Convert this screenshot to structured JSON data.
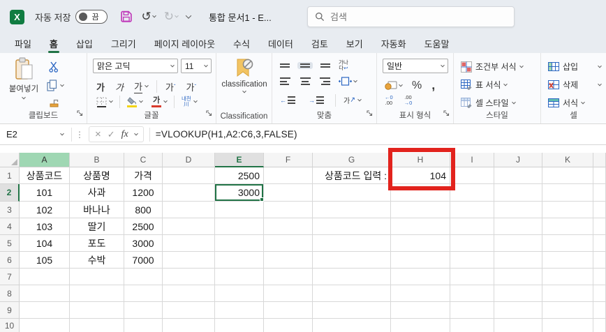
{
  "colors": {
    "accent_green": "#217346",
    "annotation_red": "#e2231d",
    "column_a_green": "#9fd7b3",
    "save_magenta": "#c03bba"
  },
  "titlebar": {
    "autosave_label": "자동 저장",
    "autosave_state": "끔",
    "document_title": "통합 문서1 - E...",
    "search_placeholder": "검색"
  },
  "tabs": {
    "items": [
      "파일",
      "홈",
      "삽입",
      "그리기",
      "페이지 레이아웃",
      "수식",
      "데이터",
      "검토",
      "보기",
      "자동화",
      "도움말"
    ],
    "active": "홈"
  },
  "ribbon": {
    "clipboard": {
      "paste_label": "붙여넣기",
      "group_label": "클립보드"
    },
    "font": {
      "font_name": "맑은 고딕",
      "font_size": "11",
      "bold": "가",
      "italic": "가",
      "underline": "가",
      "grow": "가",
      "shrink": "가",
      "phonetic_top": "내천",
      "group_label": "글꼴"
    },
    "classification": {
      "button_label": "classification",
      "group_label": "Classification"
    },
    "alignment": {
      "orientation_top": "가나",
      "orientation_bottom": "다",
      "rotate": "가",
      "group_label": "맞춤"
    },
    "number": {
      "format_value": "일반",
      "percent": "%",
      "comma": ",",
      "inc_top": "←0",
      "inc_bottom": ".00",
      "dec_top": ".00",
      "dec_bottom": "→0",
      "group_label": "표시 형식"
    },
    "styles": {
      "conditional_label": "조건부 서식",
      "table_label": "표 서식",
      "cell_styles_label": "셀 스타일",
      "group_label": "스타일"
    },
    "cells": {
      "insert_label": "삽입",
      "delete_label": "삭제",
      "format_label": "서식",
      "group_label": "셀"
    }
  },
  "formula_bar": {
    "name_box": "E2",
    "cancel": "×",
    "enter": "✓",
    "fx_label": "fx",
    "formula": "=VLOOKUP(H1,A2:C6,3,FALSE)"
  },
  "grid": {
    "selected_cell": "E2",
    "annotation_cell": "H1",
    "columns": [
      {
        "letter": "A",
        "width": 72,
        "state": "green"
      },
      {
        "letter": "B",
        "width": 78
      },
      {
        "letter": "C",
        "width": 55
      },
      {
        "letter": "D",
        "width": 75
      },
      {
        "letter": "E",
        "width": 70,
        "state": "selected"
      },
      {
        "letter": "F",
        "width": 70
      },
      {
        "letter": "G",
        "width": 112
      },
      {
        "letter": "H",
        "width": 85
      },
      {
        "letter": "I",
        "width": 63
      },
      {
        "letter": "J",
        "width": 69
      },
      {
        "letter": "K",
        "width": 73
      },
      {
        "letter": "",
        "width": 18
      }
    ],
    "rows": [
      {
        "n": "1",
        "h": 24
      },
      {
        "n": "2",
        "h": 25,
        "selected": true
      },
      {
        "n": "3",
        "h": 24
      },
      {
        "n": "4",
        "h": 24
      },
      {
        "n": "5",
        "h": 24
      },
      {
        "n": "6",
        "h": 24
      },
      {
        "n": "7",
        "h": 24
      },
      {
        "n": "8",
        "h": 24
      },
      {
        "n": "9",
        "h": 24
      },
      {
        "n": "10",
        "h": 20
      }
    ],
    "cells": [
      {
        "ref": "A1",
        "v": "상품코드",
        "align": "c"
      },
      {
        "ref": "B1",
        "v": "상품명",
        "align": "c"
      },
      {
        "ref": "C1",
        "v": "가격",
        "align": "c"
      },
      {
        "ref": "E1",
        "v": "2500",
        "align": "r"
      },
      {
        "ref": "G1",
        "v": "상품코드 입력 :",
        "align": "r"
      },
      {
        "ref": "H1",
        "v": "104",
        "align": "r"
      },
      {
        "ref": "A2",
        "v": "101",
        "align": "c"
      },
      {
        "ref": "B2",
        "v": "사과",
        "align": "c"
      },
      {
        "ref": "C2",
        "v": "1200",
        "align": "c"
      },
      {
        "ref": "E2",
        "v": "3000",
        "align": "r"
      },
      {
        "ref": "A3",
        "v": "102",
        "align": "c"
      },
      {
        "ref": "B3",
        "v": "바나나",
        "align": "c"
      },
      {
        "ref": "C3",
        "v": "800",
        "align": "c"
      },
      {
        "ref": "A4",
        "v": "103",
        "align": "c"
      },
      {
        "ref": "B4",
        "v": "딸기",
        "align": "c"
      },
      {
        "ref": "C4",
        "v": "2500",
        "align": "c"
      },
      {
        "ref": "A5",
        "v": "104",
        "align": "c"
      },
      {
        "ref": "B5",
        "v": "포도",
        "align": "c"
      },
      {
        "ref": "C5",
        "v": "3000",
        "align": "c"
      },
      {
        "ref": "A6",
        "v": "105",
        "align": "c"
      },
      {
        "ref": "B6",
        "v": "수박",
        "align": "c"
      },
      {
        "ref": "C6",
        "v": "7000",
        "align": "c"
      }
    ]
  }
}
